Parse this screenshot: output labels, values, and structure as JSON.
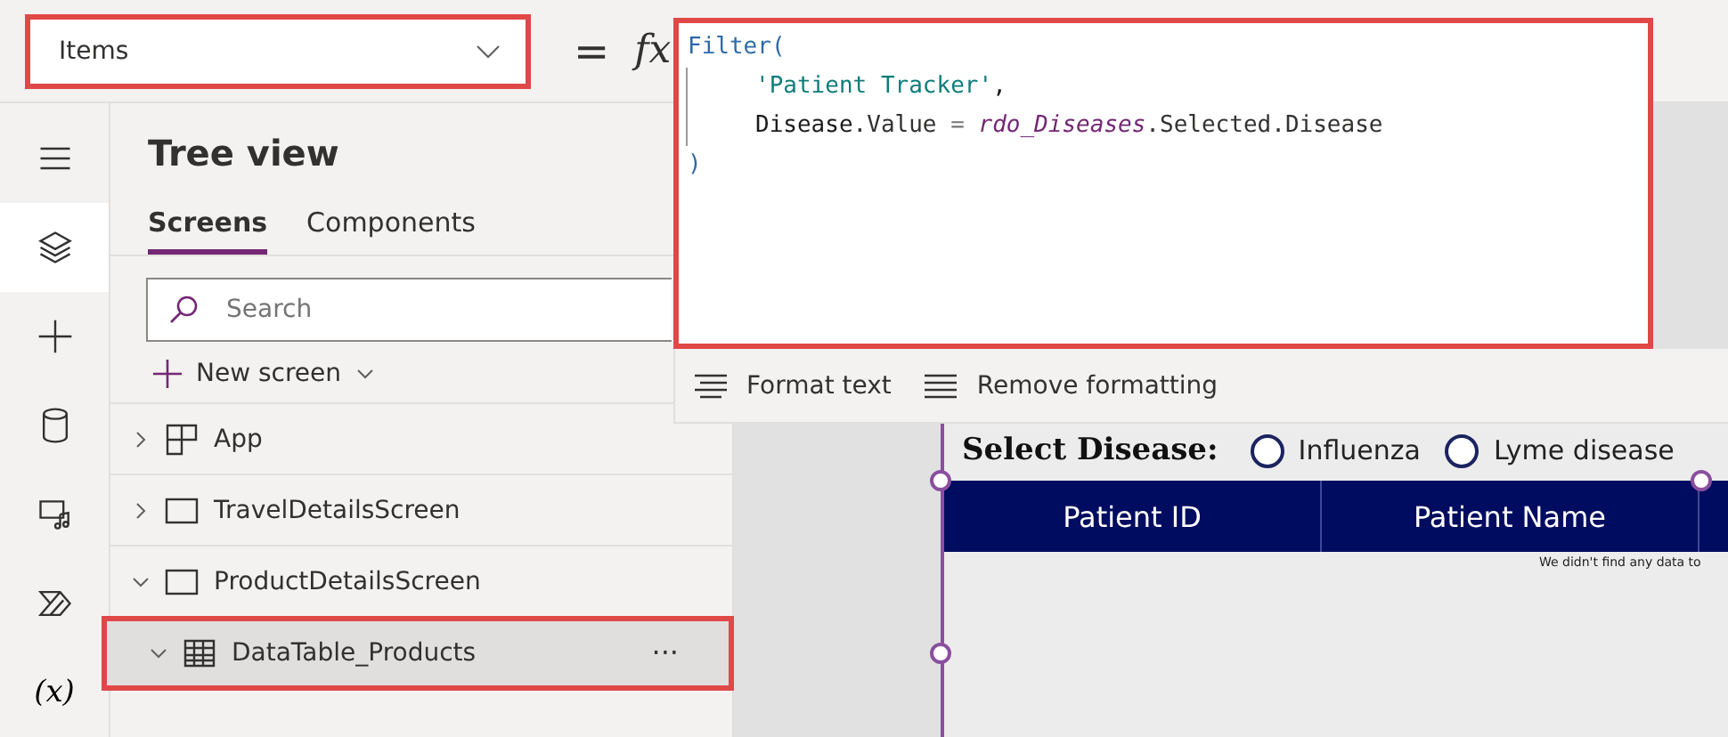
{
  "property_selector": {
    "value": "Items"
  },
  "formula_bar": {
    "equals": "=",
    "fx": "fx",
    "lines": [
      {
        "indented": false,
        "tokens": [
          {
            "text": "Filter(",
            "kind": "function"
          }
        ]
      },
      {
        "indented": true,
        "tokens": [
          {
            "text": "'Patient Tracker'",
            "kind": "string"
          },
          {
            "text": ",",
            "kind": "plain"
          }
        ]
      },
      {
        "indented": true,
        "tokens": [
          {
            "text": "Disease",
            "kind": "plain"
          },
          {
            "text": ".Value ",
            "kind": "member"
          },
          {
            "text": "= ",
            "kind": "operator"
          },
          {
            "text": "rdo_Diseases",
            "kind": "control"
          },
          {
            "text": ".Selected.Disease",
            "kind": "member"
          }
        ]
      },
      {
        "indented": false,
        "tokens": [
          {
            "text": ")",
            "kind": "function"
          }
        ]
      }
    ],
    "tools": [
      {
        "label": "Format text",
        "kind": "format"
      },
      {
        "label": "Remove formatting",
        "kind": "remove"
      }
    ]
  },
  "rail": [
    {
      "kind": "menu",
      "selected": false
    },
    {
      "kind": "layers",
      "selected": true
    },
    {
      "kind": "insert",
      "selected": false
    },
    {
      "kind": "data",
      "selected": false
    },
    {
      "kind": "media",
      "selected": false
    },
    {
      "kind": "power",
      "selected": false
    },
    {
      "kind": "variables",
      "selected": false,
      "label": "(x)"
    }
  ],
  "tree_view": {
    "title": "Tree view",
    "tabs": [
      {
        "label": "Screens",
        "selected": true
      },
      {
        "label": "Components",
        "selected": false
      }
    ],
    "search": {
      "placeholder": "Search"
    },
    "new_screen": "New screen",
    "items": [
      {
        "label": "App",
        "kind": "app",
        "expanded": false,
        "selected": false
      },
      {
        "label": "TravelDetailsScreen",
        "kind": "screen",
        "expanded": false,
        "selected": false
      },
      {
        "label": "ProductDetailsScreen",
        "kind": "screen",
        "expanded": true,
        "selected": false,
        "children": [
          {
            "label": "DataTable_Products",
            "kind": "table",
            "expanded": true,
            "selected": true,
            "more": "···"
          }
        ]
      }
    ]
  },
  "canvas": {
    "heading": "Select Disease:",
    "options": [
      {
        "label": "Influenza",
        "selected": false
      },
      {
        "label": "Lyme disease",
        "selected": false
      }
    ],
    "table": {
      "columns": [
        "Patient ID",
        "Patient Name"
      ],
      "empty_message": "We didn't find any data to"
    }
  }
}
